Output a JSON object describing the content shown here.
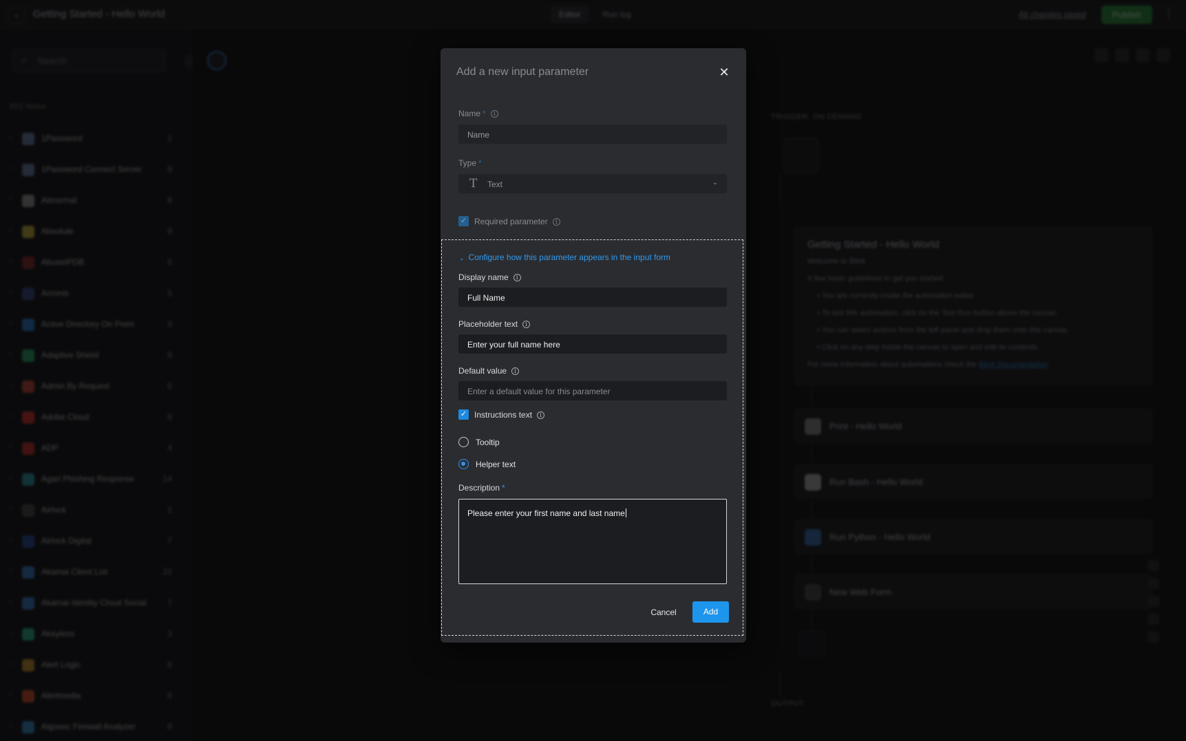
{
  "app": {
    "title": "Getting Started - Hello World",
    "modes": [
      "Editor",
      "Run log"
    ],
    "changes_saved": "All changes saved",
    "publish_label": "Publish"
  },
  "sidebar": {
    "search_placeholder": "Search",
    "items_count": "892 items",
    "items": [
      {
        "name": "1Password",
        "count": "1",
        "color": "#6a7fa8"
      },
      {
        "name": "1Password Connect Server",
        "count": "9",
        "color": "#6a7fa8"
      },
      {
        "name": "Abnormal",
        "count": "8",
        "color": "#9a9a9a"
      },
      {
        "name": "Absolute",
        "count": "9",
        "color": "#c9b23a"
      },
      {
        "name": "AbuseIPDB",
        "count": "5",
        "color": "#8a2a2a"
      },
      {
        "name": "Acronis",
        "count": "5",
        "color": "#3a4a8a"
      },
      {
        "name": "Active Directory On Prem",
        "count": "9",
        "color": "#2a7fc9"
      },
      {
        "name": "Adaptive Shield",
        "count": "8",
        "color": "#2aa86a"
      },
      {
        "name": "Admin By Request",
        "count": "5",
        "color": "#c9443a"
      },
      {
        "name": "Adobe Cloud",
        "count": "8",
        "color": "#d8312a"
      },
      {
        "name": "ADP",
        "count": "4",
        "color": "#c9302a"
      },
      {
        "name": "Agari Phishing Response",
        "count": "14",
        "color": "#2a9aa8"
      },
      {
        "name": "Airlock",
        "count": "1",
        "color": "#4a4a4a"
      },
      {
        "name": "Airlock Digital",
        "count": "7",
        "color": "#2a4a9a"
      },
      {
        "name": "Akamai Client List",
        "count": "22",
        "color": "#3a7fc9"
      },
      {
        "name": "Akamai Identity Cloud Social",
        "count": "7",
        "color": "#3a7fc9"
      },
      {
        "name": "Akeyless",
        "count": "3",
        "color": "#2ab08a"
      },
      {
        "name": "Alert Logic",
        "count": "8",
        "color": "#c9902a"
      },
      {
        "name": "Alertmedia",
        "count": "8",
        "color": "#d8512a"
      },
      {
        "name": "Algosec Firewall Analyzer",
        "count": "8",
        "color": "#3a8ac9"
      }
    ]
  },
  "canvas": {
    "trigger_label": "TRIGGER: ON DEMAND",
    "note": {
      "title": "Getting Started - Hello World",
      "welcome": "Welcome to Blink",
      "intro": "A few basic guidelines to get you started:",
      "bullets": [
        "You are currently inside the automation editor.",
        "To test this automation, click on the Test Run button above the canvas.",
        "You can select actions from the left panel and drop them onto this canvas.",
        "Click on any step inside the canvas to open and edit its contents."
      ],
      "more_info": "For more information about automations check the",
      "docs_link": "Blink Documentation"
    },
    "steps": [
      {
        "title": "Print - Hello World",
        "color": "#8a8a8a"
      },
      {
        "title": "Run Bash - Hello World",
        "color": "#b0b0b0"
      },
      {
        "title": "Run Python - Hello World",
        "color": "#3a6fb0"
      },
      {
        "title": "New Web Form",
        "color": "#4a4a4a"
      }
    ],
    "output_label": "OUTPUT"
  },
  "modal": {
    "title": "Add a new input parameter",
    "name_label": "Name",
    "name_value": "Name",
    "type_label": "Type",
    "type_value": "Text",
    "type_icon": "text-type-icon",
    "required_label": "Required parameter",
    "required_checked": true,
    "config_toggle": "Configure how this parameter appears in the input form",
    "display_name_label": "Display name",
    "display_name_value": "Full Name",
    "placeholder_label": "Placeholder text",
    "placeholder_value": "Enter your full name here",
    "default_label": "Default value",
    "default_placeholder": "Enter a default value for this parameter",
    "instructions_label": "Instructions text",
    "instructions_checked": true,
    "tooltip_label": "Tooltip",
    "helper_label": "Helper text",
    "selected_instruction": "Helper text",
    "description_label": "Description",
    "description_value": "Please enter your first name and last name",
    "cancel_label": "Cancel",
    "add_label": "Add"
  },
  "colors": {
    "accent": "#1e95ec",
    "link": "#2f9bf0",
    "publish": "#2c8b3a",
    "modal_bg": "#2b2c30",
    "field_bg": "#1c1d20"
  }
}
